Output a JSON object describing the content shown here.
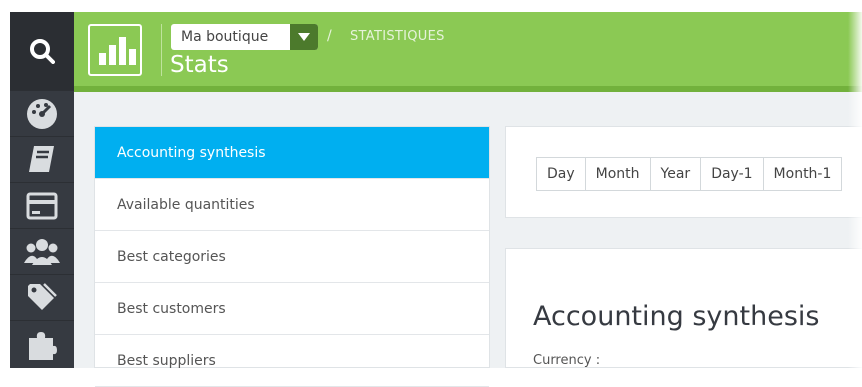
{
  "header": {
    "shop_selector": {
      "value": "Ma boutique"
    },
    "breadcrumb_separator": "/",
    "breadcrumb": "STATISTIQUES",
    "page_title": "Stats"
  },
  "rail": {
    "icons": [
      "search-icon",
      "dashboard-icon",
      "catalog-icon",
      "orders-icon",
      "customers-icon",
      "price-rules-icon",
      "modules-icon"
    ]
  },
  "stats_menu": {
    "items": [
      {
        "label": "Accounting synthesis",
        "active": true
      },
      {
        "label": "Available quantities"
      },
      {
        "label": "Best categories"
      },
      {
        "label": "Best customers"
      },
      {
        "label": "Best suppliers"
      }
    ]
  },
  "period_buttons": [
    "Day",
    "Month",
    "Year",
    "Day-1",
    "Month-1"
  ],
  "report": {
    "title": "Accounting synthesis",
    "currency_label": "Currency :"
  },
  "colors": {
    "header_green": "#8bc954",
    "rail_dark": "#363a41",
    "active_blue": "#00aff0"
  }
}
